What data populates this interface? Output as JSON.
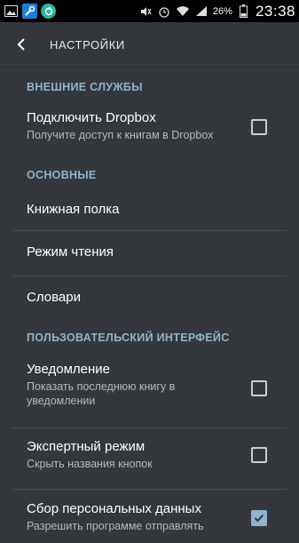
{
  "statusbar": {
    "battery_percent": "26%",
    "time": "23:38"
  },
  "appbar": {
    "title": "НАСТРОЙКИ"
  },
  "sections": {
    "external": {
      "header": "ВНЕШНИЕ СЛУЖБЫ",
      "dropbox": {
        "title": "Подключить Dropbox",
        "summary": "Получите доступ к книгам в Dropbox",
        "checked": false
      }
    },
    "main": {
      "header": "ОСНОВНЫЕ",
      "bookshelf": "Книжная полка",
      "reading_mode": "Режим чтения",
      "dictionaries": "Словари"
    },
    "ui": {
      "header": "ПОЛЬЗОВАТЕЛЬСКИЙ ИНТЕРФЕЙС",
      "notification": {
        "title": "Уведомление",
        "summary": "Показать последнюю книгу в уведомлении",
        "checked": false
      },
      "expert": {
        "title": "Экспертный режим",
        "summary": "Скрыть названия кнопок",
        "checked": false
      },
      "personal_data": {
        "title": "Сбор персональных данных",
        "summary": "Разрешить программе отправлять",
        "checked": true
      }
    }
  },
  "colors": {
    "background": "#34373c",
    "accent": "#8fb4cc"
  }
}
